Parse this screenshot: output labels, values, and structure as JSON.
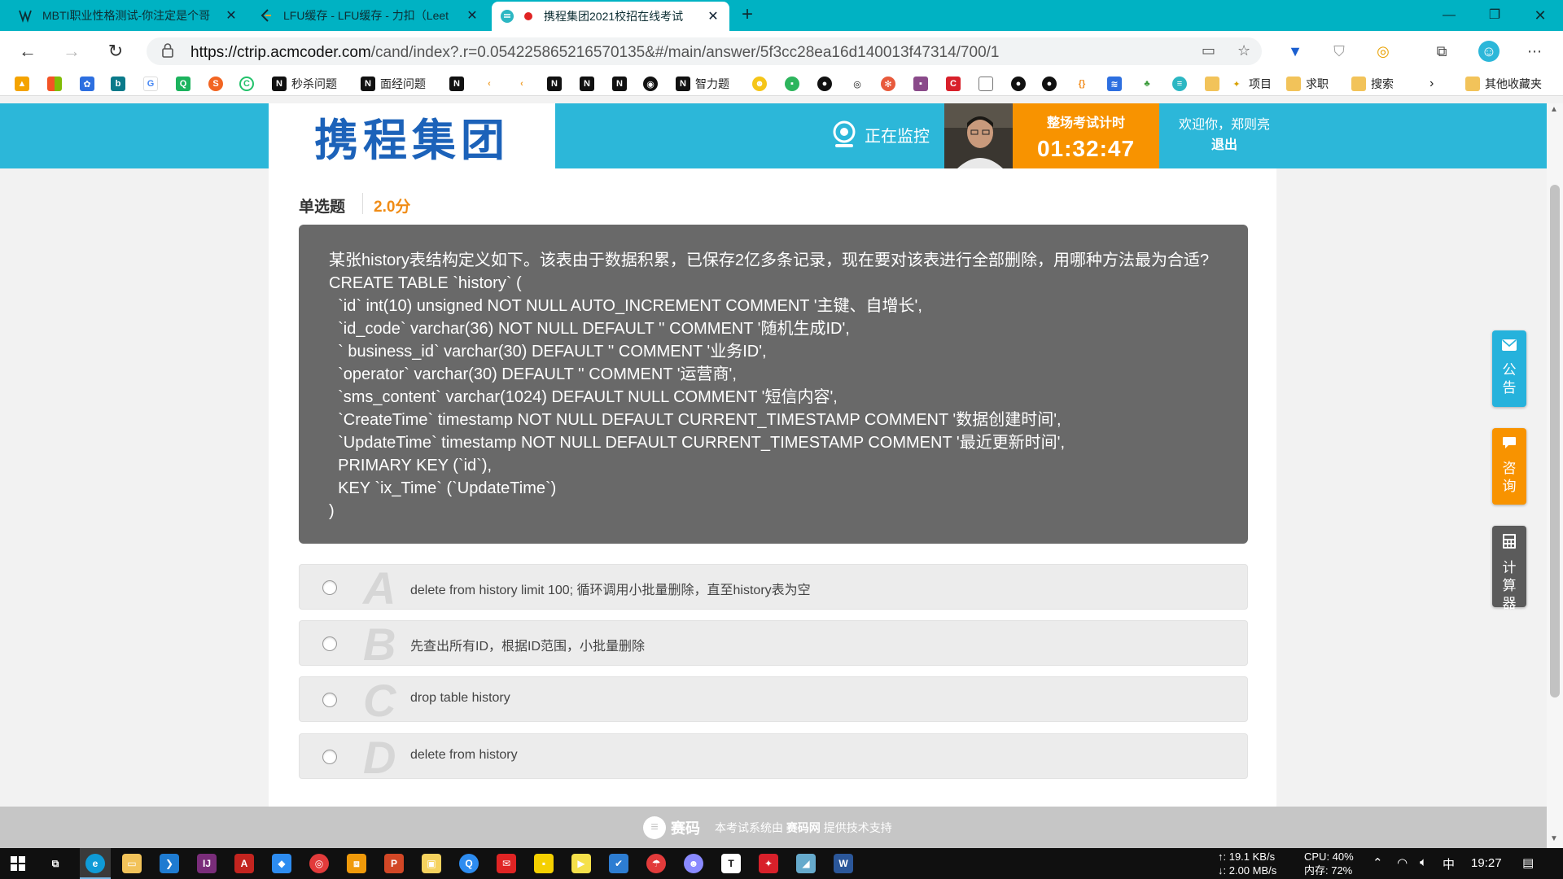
{
  "browser": {
    "tabs": [
      {
        "title": "MBTI职业性格测试-你注定是个哥",
        "icon": "mbti-icon"
      },
      {
        "title": "LFU缓存 - LFU缓存 - 力扣（Leet",
        "icon": "leetcode-icon"
      },
      {
        "title": "携程集团2021校招在线考试",
        "icon": "saima-icon"
      }
    ],
    "url_host": "https://ctrip.acmcoder.com",
    "url_path": "/cand/index?.r=0.054225865216570135&#/main/answer/5f3cc28ea16d140013f47314/700/1",
    "bookmarks": [
      "秒杀问题",
      "面经问题",
      "智力题",
      "项目",
      "求职",
      "搜索",
      "其他收藏夹"
    ]
  },
  "header": {
    "logo_text": "携程集团",
    "monitor_text": "正在监控",
    "timer_label": "整场考试计时",
    "timer_value": "01:32:47",
    "welcome_text": "欢迎你，郑则亮",
    "logout_label": "退出"
  },
  "question": {
    "type": "单选题",
    "score": "2.0分",
    "lines": [
      "某张history表结构定义如下。该表由于数据积累，已保存2亿多条记录，现在要对该表进行全部删除，用哪种方法最为合适?",
      "CREATE TABLE `history` (",
      "  `id` int(10) unsigned NOT NULL AUTO_INCREMENT COMMENT '主键、自增长',",
      "  `id_code` varchar(36) NOT NULL DEFAULT '' COMMENT '随机生成ID',",
      "  ` business_id` varchar(30) DEFAULT '' COMMENT '业务ID',",
      "  `operator` varchar(30) DEFAULT '' COMMENT '运营商',",
      "  `sms_content` varchar(1024) DEFAULT NULL COMMENT '短信内容',",
      "  `CreateTime` timestamp NOT NULL DEFAULT CURRENT_TIMESTAMP COMMENT '数据创建时间',",
      "  `UpdateTime` timestamp NOT NULL DEFAULT CURRENT_TIMESTAMP COMMENT '最近更新时间',",
      "  PRIMARY KEY (`id`),",
      "  KEY `ix_Time` (`UpdateTime`)",
      ")"
    ],
    "options": [
      {
        "letter": "A",
        "text": "delete from history limit 100; 循环调用小批量删除，直至history表为空"
      },
      {
        "letter": "B",
        "text": "先查出所有ID，根据ID范围，小批量删除"
      },
      {
        "letter": "C",
        "text": "drop table history"
      },
      {
        "letter": "D",
        "text": "delete from history"
      }
    ]
  },
  "side_tools": {
    "notice": "公告",
    "consult": "咨询",
    "calculator": "计算器"
  },
  "footer": {
    "brand": "赛码",
    "text_prefix": "本考试系统由",
    "text_brand": "赛码网",
    "text_suffix": "提供技术支持"
  },
  "taskbar": {
    "net_up": "↑: 19.1 KB/s",
    "net_down": "↓: 2.00 MB/s",
    "cpu": "CPU: 40%",
    "mem": "内存: 72%",
    "ime": "中",
    "time": "19:27"
  },
  "colors": {
    "tabbar": "#00b2c3",
    "header": "#2cb7d9",
    "timer": "#f89300",
    "score": "#f08c16",
    "question_box": "#696969",
    "logo": "#1c62b9"
  }
}
